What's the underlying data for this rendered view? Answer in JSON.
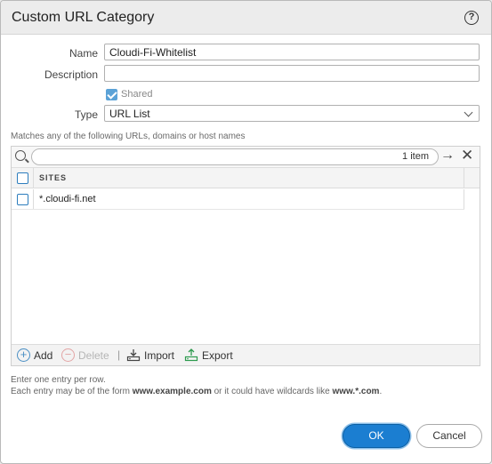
{
  "dialog": {
    "title": "Custom URL Category",
    "help_icon": "?"
  },
  "form": {
    "name_label": "Name",
    "name_value": "Cloudi-Fi-Whitelist",
    "description_label": "Description",
    "description_value": "",
    "shared_label": "Shared",
    "shared_checked": true,
    "type_label": "Type",
    "type_value": "URL List"
  },
  "grid": {
    "caption": "Matches any of the following URLs, domains or host names",
    "search_value": "",
    "item_count": "1 item",
    "column_header": "SITES",
    "rows": [
      {
        "site": "*.cloudi-fi.net",
        "checked": false
      }
    ]
  },
  "toolbar": {
    "add_label": "Add",
    "delete_label": "Delete",
    "import_label": "Import",
    "export_label": "Export",
    "separator": "|"
  },
  "help": {
    "line1": "Enter one entry per row.",
    "line2_prefix": "Each entry may be of the form ",
    "line2_example": "www.example.com",
    "line2_middle": " or it could have wildcards like ",
    "line2_wildcard": "www.*.com",
    "line2_suffix": "."
  },
  "buttons": {
    "ok": "OK",
    "cancel": "Cancel"
  },
  "icons": {
    "help": "help-circle-icon",
    "search": "search-icon",
    "arrow": "arrow-right-icon",
    "clear": "close-icon",
    "add": "plus-circle-icon",
    "delete": "minus-circle-icon",
    "import": "import-icon",
    "export": "export-icon",
    "chevron": "chevron-down-icon"
  },
  "colors": {
    "accent": "#1b7ed1",
    "checkbox": "#5ba2d7"
  }
}
